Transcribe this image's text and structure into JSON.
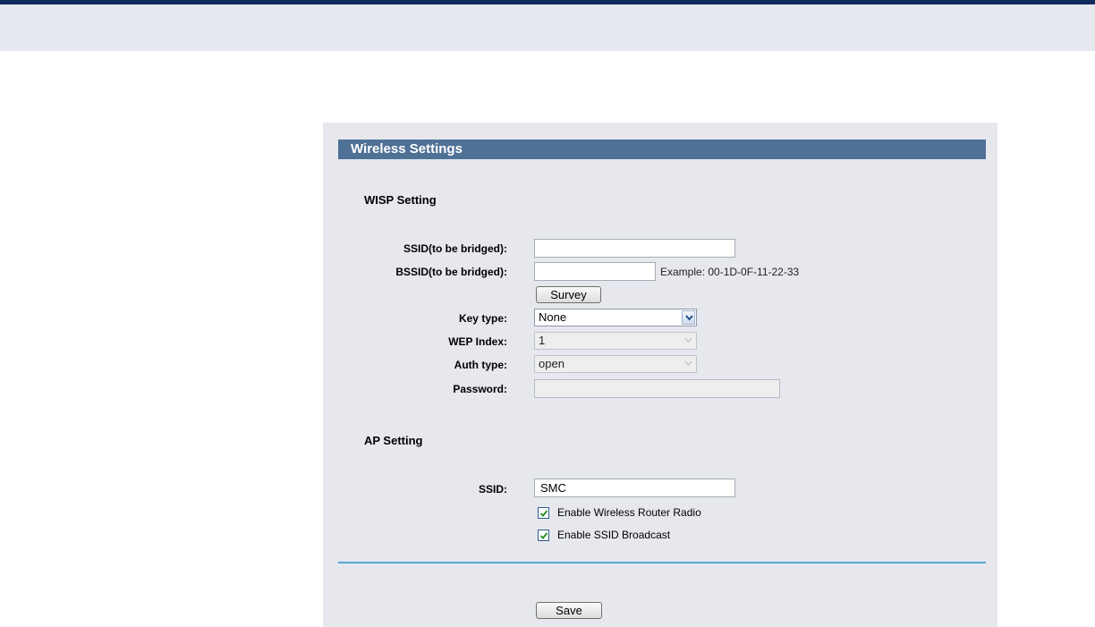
{
  "panel": {
    "title": "Wireless Settings"
  },
  "wisp": {
    "title": "WISP Setting",
    "ssid_label": "SSID(to be bridged):",
    "ssid_value": "",
    "bssid_label": "BSSID(to be bridged):",
    "bssid_value": "",
    "bssid_hint": "Example: 00-1D-0F-11-22-33",
    "survey_label": "Survey",
    "key_type_label": "Key type:",
    "key_type_value": "None",
    "wep_index_label": "WEP Index:",
    "wep_index_value": "1",
    "auth_type_label": "Auth type:",
    "auth_type_value": "open",
    "password_label": "Password:",
    "password_value": ""
  },
  "ap": {
    "title": "AP Setting",
    "ssid_label": "SSID:",
    "ssid_value": "SMC",
    "radio_label": "Enable Wireless Router Radio",
    "radio_checked": true,
    "broadcast_label": "Enable SSID Broadcast",
    "broadcast_checked": true
  },
  "actions": {
    "save_label": "Save"
  },
  "icons": {
    "select_arrow": "chevron-down-icon",
    "checkbox_check": "check-icon"
  },
  "colors": {
    "header": "#4f7196",
    "panel": "#e6e8ee",
    "divider": "#56a6d3",
    "topline": "#0f2a5c"
  }
}
